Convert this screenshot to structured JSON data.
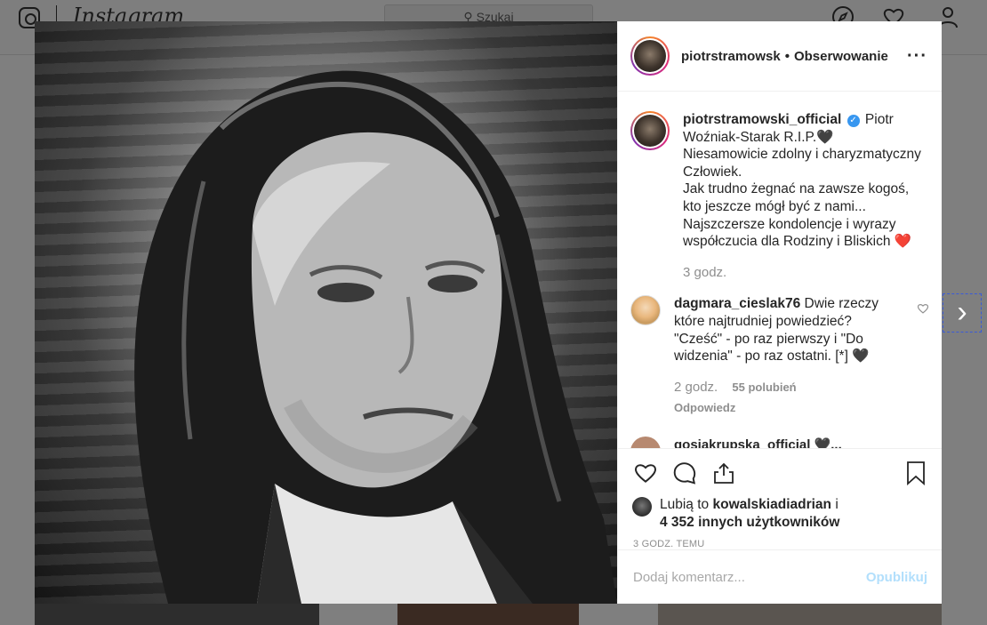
{
  "background": {
    "wordmark": "Instagram",
    "search_placeholder": "Szukaj"
  },
  "post": {
    "header": {
      "username": "piotrstramowsk",
      "separator": "•",
      "follow_label": "Obserwowanie",
      "more_label": "···"
    },
    "caption": {
      "username": "piotrstramowski_official",
      "text": "Piotr Woźniak-Starak R.I.P.🖤\nNiesamowicie zdolny i charyzmatyczny Człowiek.\nJak trudno żegnać na zawsze kogoś, kto jeszcze mógł być z nami...\nNajszczersze kondolencje i wyrazy współczucia dla Rodziny i Bliskich ❤️",
      "time": "3 godz."
    },
    "comments": [
      {
        "username": "dagmara_cieslak76",
        "text": "Dwie rzeczy które najtrudniej powiedzieć? \"Cześć\" - po raz pierwszy i \"Do widzenia\" - po raz ostatni. [*] 🖤",
        "time": "2 godz.",
        "likes": "55 polubień",
        "reply_label": "Odpowiedz"
      }
    ],
    "partial_comment": "gosiakrupska_official  🖤...",
    "likes": {
      "prefix": "Lubią to",
      "user": "kowalskiadiadrian",
      "conj": "i",
      "others": "4 352 innych użytkowników"
    },
    "time_ago": "3 GODZ. TEMU",
    "add_comment": {
      "placeholder": "Dodaj komentarz...",
      "publish_label": "Opublikuj"
    }
  },
  "colors": {
    "accent": "#3897f0",
    "publish_disabled": "#b2dffc",
    "overlay": "#7f7f7f"
  }
}
